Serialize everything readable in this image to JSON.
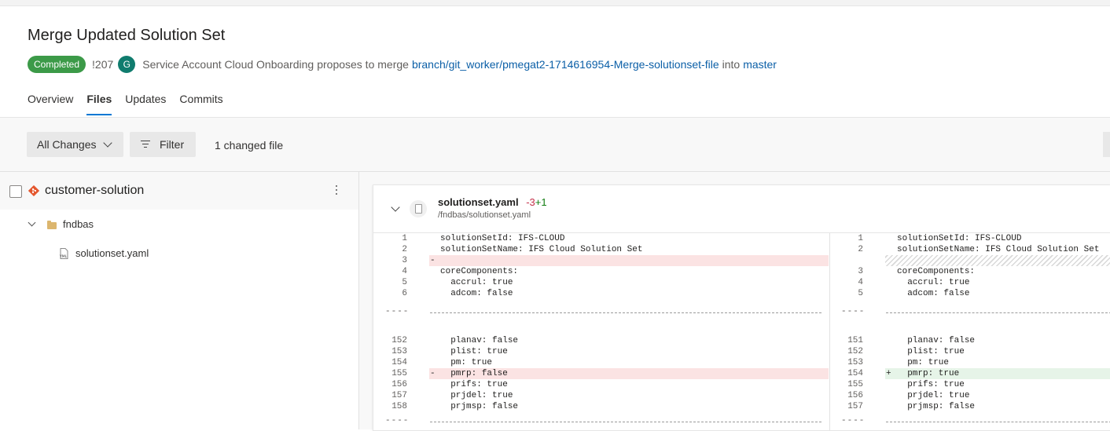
{
  "pr": {
    "title": "Merge Updated Solution Set",
    "status": "Completed",
    "id": "!207",
    "author_initial": "G",
    "author": "Service Account Cloud Onboarding",
    "proposes_text": "proposes to merge",
    "source_branch": "branch/git_worker/pmegat2-1714616954-Merge-solutionset-file",
    "into_text": "into",
    "target_branch": "master"
  },
  "tabs": [
    {
      "label": "Overview",
      "active": false
    },
    {
      "label": "Files",
      "active": true
    },
    {
      "label": "Updates",
      "active": false
    },
    {
      "label": "Commits",
      "active": false
    }
  ],
  "toolbar": {
    "changes_label": "All Changes",
    "filter_label": "Filter",
    "changed_count": "1 changed file"
  },
  "tree": {
    "repo": "customer-solution",
    "folder": "fndbas",
    "file": "solutionset.yaml",
    "file_icon_text": "YML"
  },
  "diff": {
    "file_name": "solutionset.yaml",
    "deletions": "-3",
    "additions": "+1",
    "file_path": "/fndbas/solutionset.yaml",
    "separator_ln": "----",
    "left": [
      {
        "ln": "1",
        "mk": "",
        "code": "solutionSetId: IFS-CLOUD",
        "type": "ctx"
      },
      {
        "ln": "2",
        "mk": "",
        "code": "solutionSetName: IFS Cloud Solution Set",
        "type": "ctx"
      },
      {
        "ln": "3",
        "mk": "-",
        "code": "",
        "type": "del"
      },
      {
        "ln": "4",
        "mk": "",
        "code": "coreComponents:",
        "type": "ctx"
      },
      {
        "ln": "5",
        "mk": "",
        "code": "  accrul: true",
        "type": "ctx"
      },
      {
        "ln": "6",
        "mk": "",
        "code": "  adcom: false",
        "type": "ctx"
      },
      {
        "ln": "152",
        "mk": "",
        "code": "  planav: false",
        "type": "ctx"
      },
      {
        "ln": "153",
        "mk": "",
        "code": "  plist: true",
        "type": "ctx"
      },
      {
        "ln": "154",
        "mk": "",
        "code": "  pm: true",
        "type": "ctx"
      },
      {
        "ln": "155",
        "mk": "-",
        "code": "  pmrp: false",
        "type": "del"
      },
      {
        "ln": "156",
        "mk": "",
        "code": "  prifs: true",
        "type": "ctx"
      },
      {
        "ln": "157",
        "mk": "",
        "code": "  prjdel: true",
        "type": "ctx"
      },
      {
        "ln": "158",
        "mk": "",
        "code": "  prjmsp: false",
        "type": "ctx"
      }
    ],
    "right": [
      {
        "ln": "1",
        "mk": "",
        "code": "solutionSetId: IFS-CLOUD",
        "type": "ctx"
      },
      {
        "ln": "2",
        "mk": "",
        "code": "solutionSetName: IFS Cloud Solution Set",
        "type": "ctx"
      },
      {
        "ln": "",
        "mk": "",
        "code": "",
        "type": "empty"
      },
      {
        "ln": "3",
        "mk": "",
        "code": "coreComponents:",
        "type": "ctx"
      },
      {
        "ln": "4",
        "mk": "",
        "code": "  accrul: true",
        "type": "ctx"
      },
      {
        "ln": "5",
        "mk": "",
        "code": "  adcom: false",
        "type": "ctx"
      },
      {
        "ln": "151",
        "mk": "",
        "code": "  planav: false",
        "type": "ctx"
      },
      {
        "ln": "152",
        "mk": "",
        "code": "  plist: true",
        "type": "ctx"
      },
      {
        "ln": "153",
        "mk": "",
        "code": "  pm: true",
        "type": "ctx"
      },
      {
        "ln": "154",
        "mk": "+",
        "code": "  pmrp: true",
        "type": "add"
      },
      {
        "ln": "155",
        "mk": "",
        "code": "  prifs: true",
        "type": "ctx"
      },
      {
        "ln": "156",
        "mk": "",
        "code": "  prjdel: true",
        "type": "ctx"
      },
      {
        "ln": "157",
        "mk": "",
        "code": "  prjmsp: false",
        "type": "ctx"
      }
    ]
  }
}
